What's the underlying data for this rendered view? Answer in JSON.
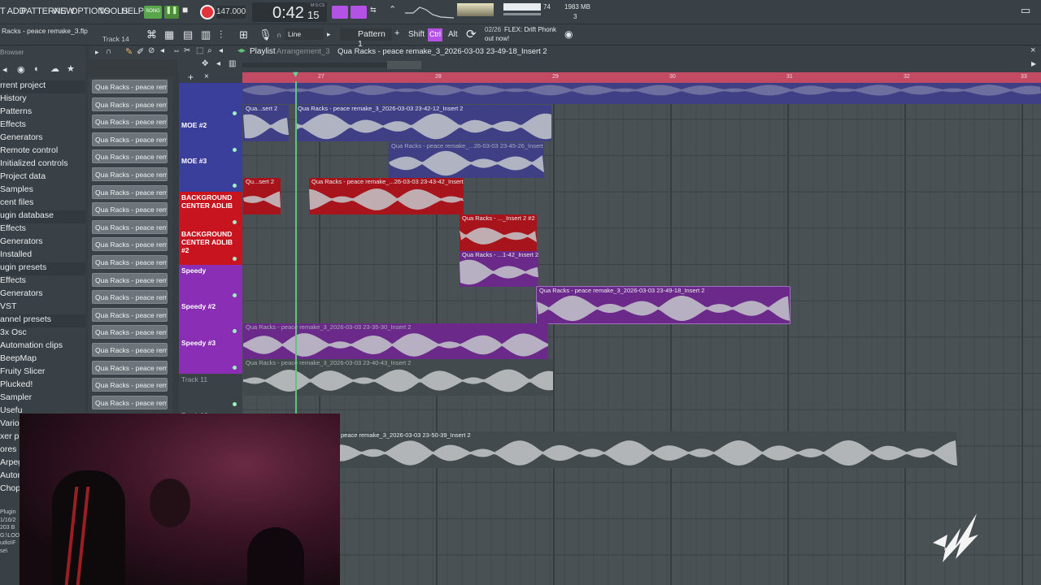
{
  "menu": {
    "items": [
      "T ADD",
      "PATTERNS",
      "VIEW",
      "OPTIONS",
      "TOOLS",
      "HELP"
    ]
  },
  "transport": {
    "song_label": "SONG",
    "tempo": "147.000",
    "time": "0:42",
    "time_small": "15",
    "time_unit": "M:S:CS"
  },
  "status": {
    "memory": "1983 MB",
    "cpu": "74",
    "polyphony": "3"
  },
  "project": {
    "file": "Racks - peace remake_3.flp",
    "track_hint": "Track 14",
    "snap": "Line",
    "pattern": "Pattern 1",
    "shift": "Shift",
    "ctrl": "Ctrl",
    "alt": "Alt",
    "news_date": "02/26",
    "news_text": "FLEX: Drift Phonk",
    "news_text2": "out now!"
  },
  "browser": {
    "title": "Browser",
    "items": [
      "rrent project",
      "History",
      "Patterns",
      "Effects",
      "Generators",
      "Remote control",
      "Initialized controls",
      "Project data",
      "Samples",
      "cent files",
      "ugin database",
      "Effects",
      "Generators",
      "Installed",
      "ugin presets",
      "Effects",
      "Generators",
      "VST",
      "annel presets",
      "3x Osc",
      "Automation clips",
      "BeepMap",
      "Fruity Slicer",
      "Plucked!",
      "Sampler",
      "Usefu",
      "Vario",
      "xer p",
      "ores",
      "Arpeg",
      "Autom",
      "Chopp"
    ],
    "footer": [
      "Plugin",
      "1/16/2",
      "203 B",
      "G:\\LOO",
      "udio\\F",
      "se\\"
    ]
  },
  "channels": {
    "items": [
      "Qua Racks - peace remak",
      "Qua Racks - peace remak",
      "Qua Racks - peace remak",
      "Qua Racks - peace remak",
      "Qua Racks - peace remak",
      "Qua Racks - peace remak",
      "Qua Racks - peace remak",
      "Qua Racks - peace remak",
      "Qua Racks - peace remak",
      "Qua Racks - peace remak",
      "Qua Racks - peace remak",
      "Qua Racks - peace remak",
      "Qua Racks - peace remak",
      "Qua Racks - peace remak",
      "Qua Racks - peace remak",
      "Qua Racks - peace remak",
      "Qua Racks - peace remak",
      "Qua Racks - peace remak",
      "Qua Racks - peace remak"
    ]
  },
  "playlist": {
    "title": "Playlist",
    "arrangement": "Arrangement_3",
    "selected_clip": "Qua Racks - peace remake_3_2026-03-03 23-49-18_Insert 2",
    "ruler_bars": [
      "27",
      "28",
      "29",
      "30",
      "31",
      "32",
      "33"
    ],
    "tracks": [
      {
        "name": "",
        "color": "#3b3f9c"
      },
      {
        "name": "MOE #2",
        "color": "#3b3f9c"
      },
      {
        "name": "MOE #3",
        "color": "#3b3f9c"
      },
      {
        "name": "BACKGROUND CENTER ADLIB",
        "color": "#c8141e"
      },
      {
        "name": "BACKGROUND CENTER ADLIB #2",
        "color": "#c8141e"
      },
      {
        "name": "Speedy",
        "color": "#8a2fb5"
      },
      {
        "name": "Speedy #2",
        "color": "#8a2fb5"
      },
      {
        "name": "Speedy #3",
        "color": "#8a2fb5"
      },
      {
        "name": "Track 11",
        "color": "#3b4247"
      },
      {
        "name": "Track 12",
        "color": "#3b4247"
      }
    ],
    "clips": [
      {
        "label": "",
        "color": "#3f3f86"
      },
      {
        "label": "Qua...sert 2",
        "color": "#3f3f86"
      },
      {
        "label": "Qua Racks - peace remake_3_2026-03-03 23-42-12_Insert 2",
        "color": "#3f3f86"
      },
      {
        "label": "Qua Racks - peace remake_...26-03-03 23-45-26_Insert 2",
        "color": "#3f3f86"
      },
      {
        "label": "Qu...sert 2",
        "color": "#a8141c"
      },
      {
        "label": "Qua Racks - peace remake_...26-03-03 23-43-42_Insert 2",
        "color": "#a8141c"
      },
      {
        "label": "Qua Racks - ..._Insert 2 #2",
        "color": "#a8141c"
      },
      {
        "label": "Qua Racks - ...1-42_Insert 2",
        "color": "#6b2a8a"
      },
      {
        "label": "Qua Racks - peace remake_3_2026-03-03 23-49-18_Insert 2",
        "color": "#6b2a8a"
      },
      {
        "label": "Qua Racks - peace remake_3_2026-03-03 23-35-30_Insert 2",
        "color": "#6b2a8a"
      },
      {
        "label": "Qua Racks - peace remake_3_2026-03-03 23-40-43_Insert 2",
        "color": "#424a4e"
      },
      {
        "label": "peace remake_3_2026-03-03 23-50-39_Insert 2",
        "color": "#424a4e"
      }
    ]
  }
}
